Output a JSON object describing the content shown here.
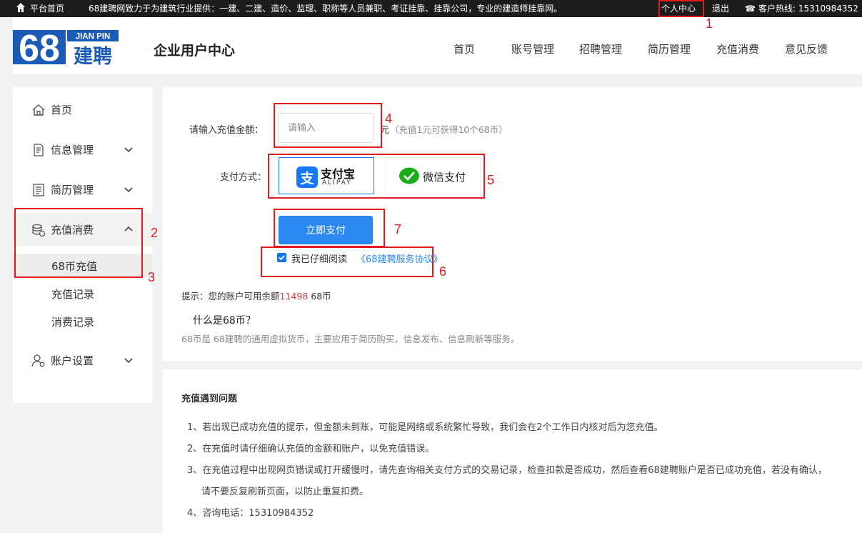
{
  "topbar": {
    "home_label": "平台首页",
    "slogan": "68建聘网致力于为建筑行业提供：一建、二建、造价、监理、职称等人员兼职、考证挂靠、挂靠公司，专业的建造师挂靠网。",
    "personal_center": "个人中心",
    "logout": "退出",
    "hotline": "客户热线: 15310984352"
  },
  "header": {
    "logo": {
      "number": "68",
      "en": "JIAN PIN",
      "cn": "建聘"
    },
    "title": "企业用户中心",
    "nav": [
      "首页",
      "账号管理",
      "招聘管理",
      "简历管理",
      "充值消费",
      "意见反馈"
    ]
  },
  "sidebar": {
    "items": [
      {
        "label": "首页",
        "icon": "home-icon"
      },
      {
        "label": "信息管理",
        "icon": "document-icon"
      },
      {
        "label": "简历管理",
        "icon": "resume-icon"
      },
      {
        "label": "充值消费",
        "icon": "coins-icon"
      },
      {
        "label": "账户设置",
        "icon": "user-settings-icon"
      }
    ],
    "sub_items": [
      "68币充值",
      "充值记录",
      "消费记录"
    ]
  },
  "recharge": {
    "amount_label": "请输入充值金额：",
    "amount_placeholder": "请输入",
    "unit": "元",
    "hint": "（充值1元可获得10个68币）",
    "pay_method_label": "支付方式：",
    "alipay_label": "支付宝",
    "alipay_en": "ALIPAY",
    "wechat_label": "微信支付",
    "pay_button": "立即支付",
    "agree_text": "我已仔细阅读",
    "agree_link": "《68建聘服务协议》",
    "balance_prefix": "提示：您的账户可用余额",
    "balance_value": "11498",
    "balance_suffix": "68币",
    "what_title": "什么是68币？",
    "what_desc": "68币是 68建聘的通用虚拟货币，主要应用于简历购买，信息发布、信息刷新等服务。"
  },
  "faq": {
    "title": "充值遇到问题",
    "lines": [
      "1、若出现已成功充值的提示，但金额未到账，可能是网络或系统繁忙导致，我们会在2个工作日内核对后为您充值。",
      "2、在充值时请仔细确认充值的金额和账户，以免充值错误。",
      "3、在充值过程中出现网页错误或打开缓慢时，请先查询相关支付方式的交易记录，检查扣款是否成功，然后查看68建聘账户是否已成功充值，若没有确认，",
      "请不要反复刷新页面，以防止重复扣费。",
      "4、咨询电话：15310984352"
    ]
  },
  "annotations": [
    "1",
    "2",
    "3",
    "4",
    "5",
    "6",
    "7"
  ],
  "colors": {
    "accent": "#2b88f2",
    "annotation": "#e21c1c",
    "logo_blue": "#1a5bb8",
    "balance": "#e4393c"
  }
}
